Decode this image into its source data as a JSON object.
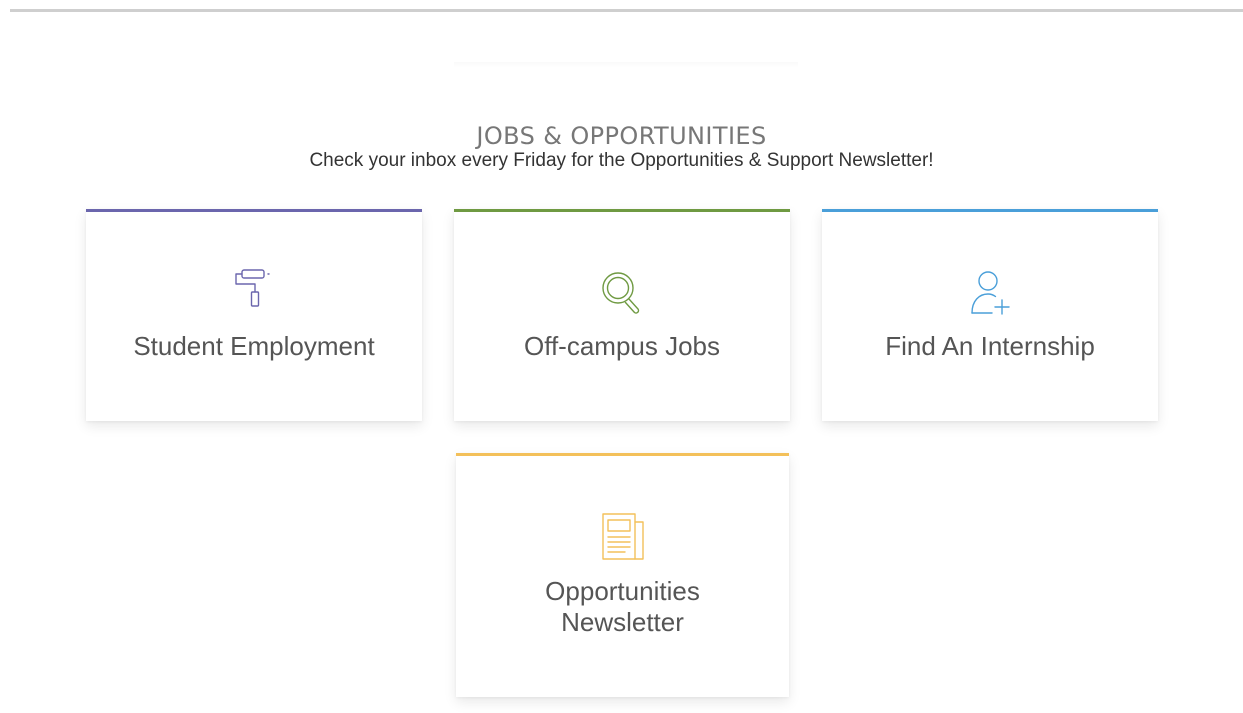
{
  "section": {
    "title": "JOBS & OPPORTUNITIES",
    "subtitle": "Check your inbox every Friday for the Opportunities & Support Newsletter!"
  },
  "cards": [
    {
      "label": "Student Employment",
      "icon": "paint-roller-icon",
      "accent_color": "#6b66ad"
    },
    {
      "label": "Off-campus Jobs",
      "icon": "magnifying-glass-icon",
      "accent_color": "#6f9a42"
    },
    {
      "label": "Find An Internship",
      "icon": "add-user-icon",
      "accent_color": "#4a9fd9"
    },
    {
      "label_lines": [
        "Opportunities",
        "Newsletter"
      ],
      "icon": "newspaper-icon",
      "accent_color": "#f3c05a"
    }
  ]
}
